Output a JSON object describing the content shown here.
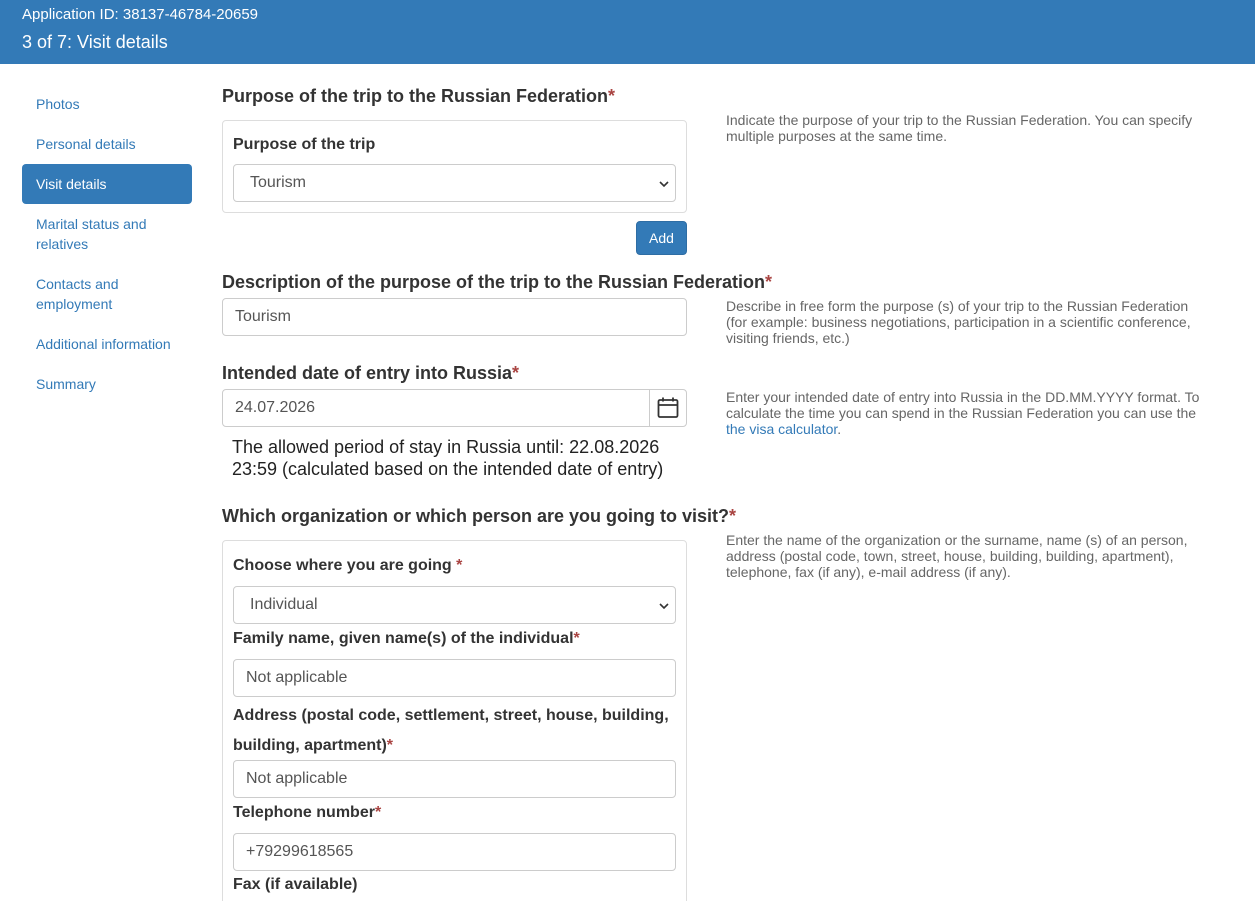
{
  "header": {
    "application_id": "Application ID: 38137-46784-20659",
    "step": "3 of 7: Visit details"
  },
  "sidebar": {
    "items": [
      {
        "label": "Photos"
      },
      {
        "label": "Personal details"
      },
      {
        "label": "Visit details",
        "active": true
      },
      {
        "label": "Marital status and relatives"
      },
      {
        "label": "Contacts and employment"
      },
      {
        "label": "Additional information"
      },
      {
        "label": "Summary"
      }
    ]
  },
  "purpose": {
    "title": "Purpose of the trip to the Russian Federation",
    "field_label": "Purpose of the trip",
    "selected": "Tourism",
    "add_button": "Add",
    "help": "Indicate the purpose of your trip to the Russian Federation. You can specify multiple purposes at the same time."
  },
  "description": {
    "title": "Description of the purpose of the trip to the Russian Federation",
    "value": "Tourism",
    "help": "Describe in free form the purpose (s) of your trip to the Russian Federation (for example: business negotiations, participation in a scientific conference, visiting friends, etc.)"
  },
  "entry_date": {
    "title": "Intended date of entry into Russia",
    "value": "24.07.2026",
    "stay_note": "The allowed period of stay in Russia until: 22.08.2026 23:59 (calculated based on the intended date of entry)",
    "help_prefix": "Enter your intended date of entry into Russia in the DD.MM.YYYY format. To calculate the time you can spend in the Russian Federation you can use the ",
    "help_link": "the visa calculator",
    "help_suffix": "."
  },
  "visit": {
    "title": "Which organization or which person are you going to visit?",
    "help": "Enter the name of the organization or the surname, name (s) of an person, address (postal code, town, street, house, building, building, apartment), telephone, fax (if any), e-mail address (if any).",
    "where_label": "Choose where you are going",
    "where_value": "Individual",
    "name_label": "Family name, given name(s) of the individual",
    "name_value": "Not applicable",
    "address_label_1": "Address (postal code, settlement, street, house, building,",
    "address_label_2": "building, apartment)",
    "address_value": "Not applicable",
    "phone_label": "Telephone number",
    "phone_value": "+79299618565",
    "fax_label": "Fax (if available)"
  },
  "required_mark": "*"
}
